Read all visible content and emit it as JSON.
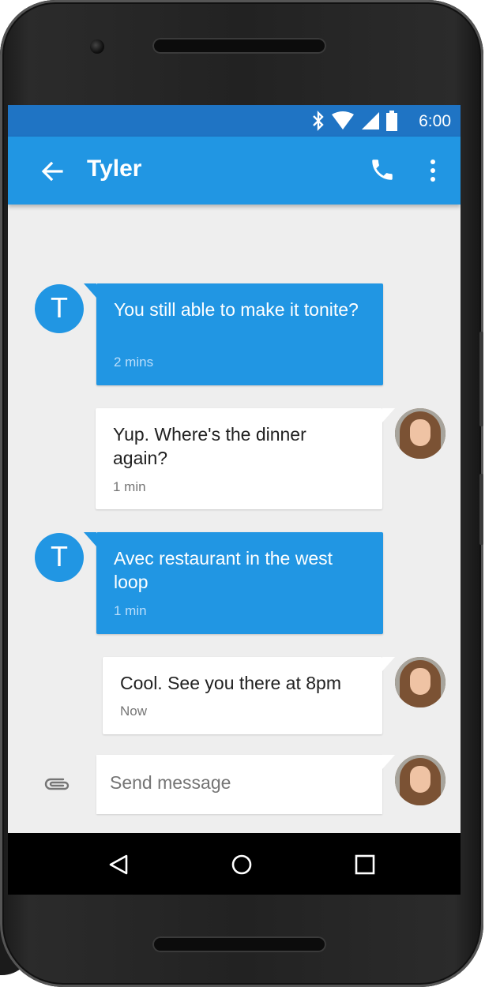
{
  "status_bar": {
    "time": "6:00",
    "icons": [
      "bluetooth-icon",
      "wifi-icon",
      "signal-icon",
      "battery-icon"
    ]
  },
  "app_bar": {
    "title": "Tyler",
    "back_icon": "arrow-back-icon",
    "call_icon": "phone-icon",
    "menu_icon": "more-vert-icon"
  },
  "messages": [
    {
      "direction": "incoming",
      "avatar_letter": "T",
      "text": "You still able to make it tonite?",
      "time": "2 mins"
    },
    {
      "direction": "outgoing",
      "text": "Yup. Where's the dinner again?",
      "time": "1 min"
    },
    {
      "direction": "incoming",
      "avatar_letter": "T",
      "text": "Avec restaurant in the west loop",
      "time": "1 min"
    },
    {
      "direction": "outgoing",
      "text": "Cool. See you there at 8pm",
      "time": "Now"
    }
  ],
  "composer": {
    "placeholder": "Send message",
    "attach_icon": "paperclip-icon"
  },
  "nav_bar": {
    "icons": [
      "nav-back-icon",
      "nav-home-icon",
      "nav-recents-icon"
    ]
  },
  "colors": {
    "status_bar": "#1f74c4",
    "app_bar": "#2196e3",
    "incoming_bubble": "#2196e3",
    "outgoing_bubble": "#ffffff",
    "chat_background": "#eeeeee"
  }
}
